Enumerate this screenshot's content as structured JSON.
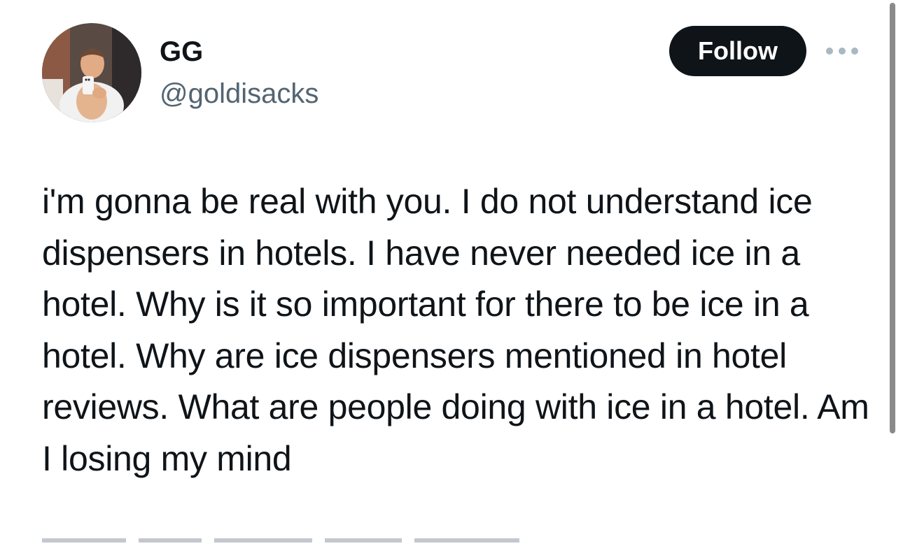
{
  "author": {
    "display_name": "GG",
    "handle": "@goldisacks",
    "avatar_icon": "profile-photo-icon"
  },
  "actions": {
    "follow_label": "Follow",
    "more_icon": "more-options-icon"
  },
  "tweet": {
    "text": "i'm gonna be real with you. I do not understand ice dispensers in hotels. I have never needed ice in a hotel. Why is it so important for there to be ice in a hotel. Why are ice dispensers mentioned in hotel reviews. What are people doing with ice in a hotel. Am I losing my mind"
  },
  "colors": {
    "text_primary": "#0f1419",
    "text_secondary": "#536471",
    "follow_bg": "#0f1419",
    "follow_text": "#ffffff"
  }
}
